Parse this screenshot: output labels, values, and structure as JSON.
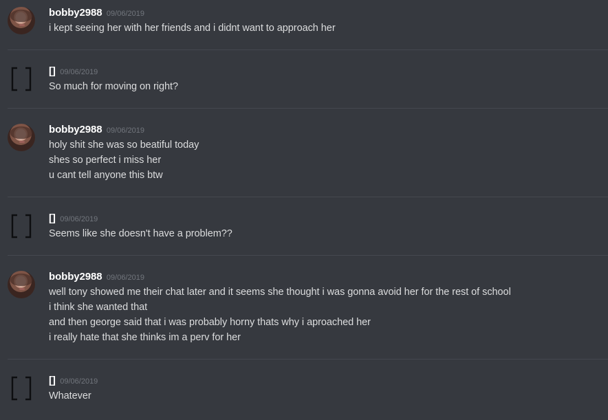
{
  "messages": [
    {
      "author": "bobby2988",
      "timestamp": "09/06/2019",
      "avatar": "profile-photo",
      "lines": [
        "i kept seeing her with her friends and i didnt want to approach her"
      ]
    },
    {
      "author": "[]",
      "timestamp": "09/06/2019",
      "avatar": "brackets-icon",
      "lines": [
        "So much for moving on right?"
      ]
    },
    {
      "author": "bobby2988",
      "timestamp": "09/06/2019",
      "avatar": "profile-photo",
      "lines": [
        "holy shit she was so beatiful today",
        "shes so perfect i miss her",
        "u cant tell anyone this btw"
      ]
    },
    {
      "author": "[]",
      "timestamp": "09/06/2019",
      "avatar": "brackets-icon",
      "lines": [
        "Seems like she doesn't have a problem??"
      ]
    },
    {
      "author": "bobby2988",
      "timestamp": "09/06/2019",
      "avatar": "profile-photo",
      "lines": [
        "well tony showed me their chat later and it seems she thought i was gonna avoid her for the rest of school",
        "i think she wanted that",
        "and then george said that i was probably horny thats why i aproached her",
        "i really hate that she thinks im a perv for her"
      ]
    },
    {
      "author": "[]",
      "timestamp": "09/06/2019",
      "avatar": "brackets-icon",
      "lines": [
        "Whatever"
      ]
    }
  ]
}
